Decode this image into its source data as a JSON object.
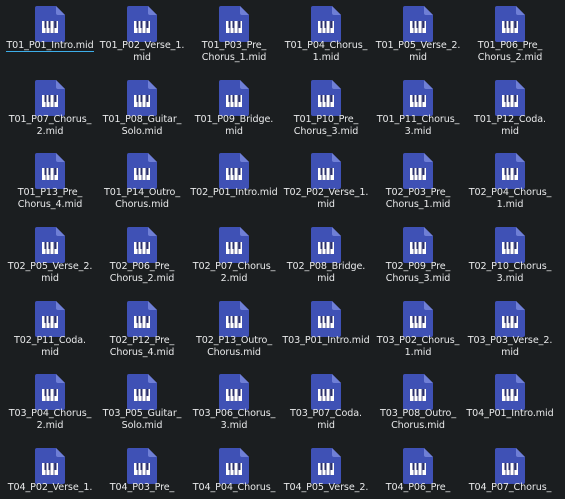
{
  "colors": {
    "background": "#1b1e20",
    "text": "#e8e9ea",
    "icon_body": "#3f51b5",
    "icon_fold": "#6f7fd6",
    "keyboard_white": "#ffffff",
    "keyboard_black": "#2a2f6b",
    "selection_accent": "#3daee9"
  },
  "file_icon": "midi-file-icon",
  "files": [
    "T01_P01_Intro.mid",
    "T01_P02_Verse_1.\nmid",
    "T01_P03_Pre_\nChorus_1.mid",
    "T01_P04_Chorus_\n1.mid",
    "T01_P05_Verse_2.\nmid",
    "T01_P06_Pre_\nChorus_2.mid",
    "T01_P07_Chorus_\n2.mid",
    "T01_P08_Guitar_\nSolo.mid",
    "T01_P09_Bridge.\nmid",
    "T01_P10_Pre_\nChorus_3.mid",
    "T01_P11_Chorus_\n3.mid",
    "T01_P12_Coda.\nmid",
    "T01_P13_Pre_\nChorus_4.mid",
    "T01_P14_Outro_\nChorus.mid",
    "T02_P01_Intro.mid",
    "T02_P02_Verse_1.\nmid",
    "T02_P03_Pre_\nChorus_1.mid",
    "T02_P04_Chorus_\n1.mid",
    "T02_P05_Verse_2.\nmid",
    "T02_P06_Pre_\nChorus_2.mid",
    "T02_P07_Chorus_\n2.mid",
    "T02_P08_Bridge.\nmid",
    "T02_P09_Pre_\nChorus_3.mid",
    "T02_P10_Chorus_\n3.mid",
    "T02_P11_Coda.\nmid",
    "T02_P12_Pre_\nChorus_4.mid",
    "T02_P13_Outro_\nChorus.mid",
    "T03_P01_Intro.mid",
    "T03_P02_Chorus_\n1.mid",
    "T03_P03_Verse_2.\nmid",
    "T03_P04_Chorus_\n2.mid",
    "T03_P05_Guitar_\nSolo.mid",
    "T03_P06_Chorus_\n3.mid",
    "T03_P07_Coda.\nmid",
    "T03_P08_Outro_\nChorus.mid",
    "T04_P01_Intro.mid",
    "T04_P02_Verse_1.",
    "T04_P03_Pre_",
    "T04_P04_Chorus_",
    "T04_P05_Verse_2.",
    "T04_P06_Pre_",
    "T04_P07_Chorus_"
  ],
  "selected_index": 0
}
